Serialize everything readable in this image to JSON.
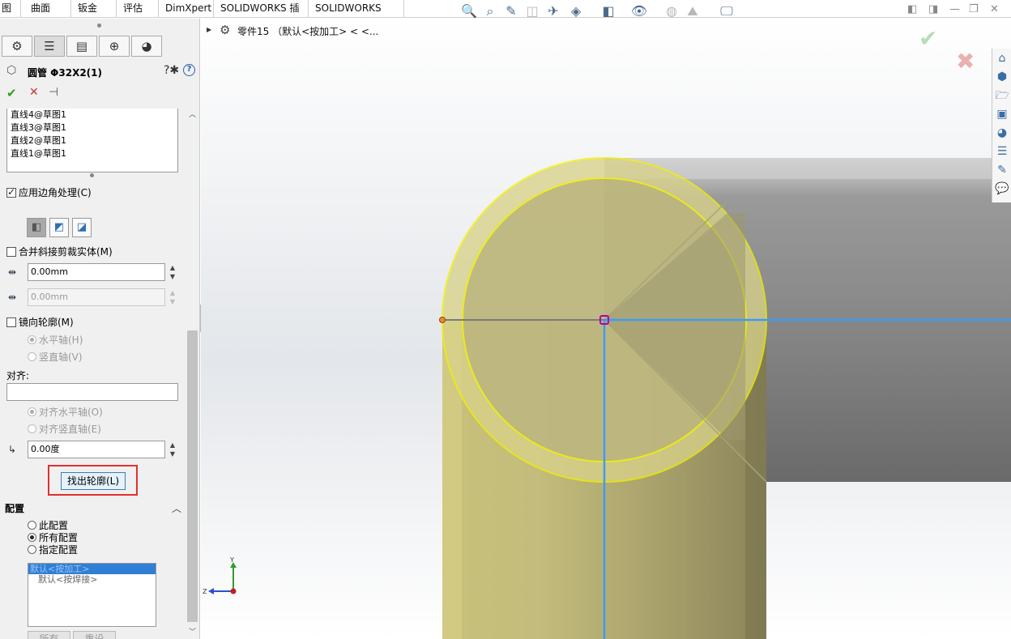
{
  "tabs": [
    {
      "label": "图",
      "active": true
    },
    {
      "label": "曲面"
    },
    {
      "label": "钣金"
    },
    {
      "label": "评估"
    },
    {
      "label": "DimXpert"
    },
    {
      "label": "SOLIDWORKS 插件"
    },
    {
      "label": "SOLIDWORKS MBD"
    }
  ],
  "toolbar_icons": [
    "zoom-to-fit-icon",
    "zoom-area-icon",
    "previous-view-icon",
    "section-view-icon",
    "dynamic-annotation-icon",
    "view-orientation-icon",
    "display-style-icon",
    "hide-show-icon",
    "edit-appearance-icon",
    "apply-scene-icon",
    "view-settings-icon"
  ],
  "property_manager": {
    "title": "圆管 Φ32X2(1)",
    "tabs": [
      "feature-manager-icon",
      "property-manager-icon",
      "configuration-manager-icon",
      "dimxpert-icon",
      "display-manager-icon"
    ],
    "segments": [
      "直线4@草图1",
      "直线3@草图1",
      "直线2@草图1",
      "直线1@草图1"
    ],
    "apply_corner_label": "应用边角处理(C)",
    "apply_corner_checked": true,
    "merge_miter_label": "合并斜接剪裁实体(M)",
    "merge_miter_checked": false,
    "gap1_value": "0.00mm",
    "gap2_value": "0.00mm",
    "mirror_label": "镜向轮廓(M)",
    "mirror_checked": false,
    "horizontal_axis_label": "水平轴(H)",
    "vertical_axis_label": "竖直轴(V)",
    "align_label": "对齐:",
    "align_value": "",
    "align_horizontal_label": "对齐水平轴(O)",
    "align_vertical_label": "对齐竖直轴(E)",
    "rotation_value": "0.00度",
    "locate_profile_label": "找出轮廓(L)"
  },
  "config_section": {
    "header": "配置",
    "options": [
      "此配置",
      "所有配置",
      "指定配置"
    ],
    "selected_option": "所有配置",
    "list": [
      "默认<按加工>",
      "默认<按焊接>"
    ],
    "selected_item": "默认<按加工>",
    "all_label": "所有",
    "reset_label": "重设"
  },
  "viewport": {
    "tree_text": "零件15 （默认<按加工> < <...",
    "triad_y": "Y",
    "triad_z": "Z"
  },
  "colors": {
    "highlight": "#f2f200",
    "tube": "#c8c08a",
    "sketch_line": "#3d9bf5",
    "red_box": "#e03030"
  }
}
